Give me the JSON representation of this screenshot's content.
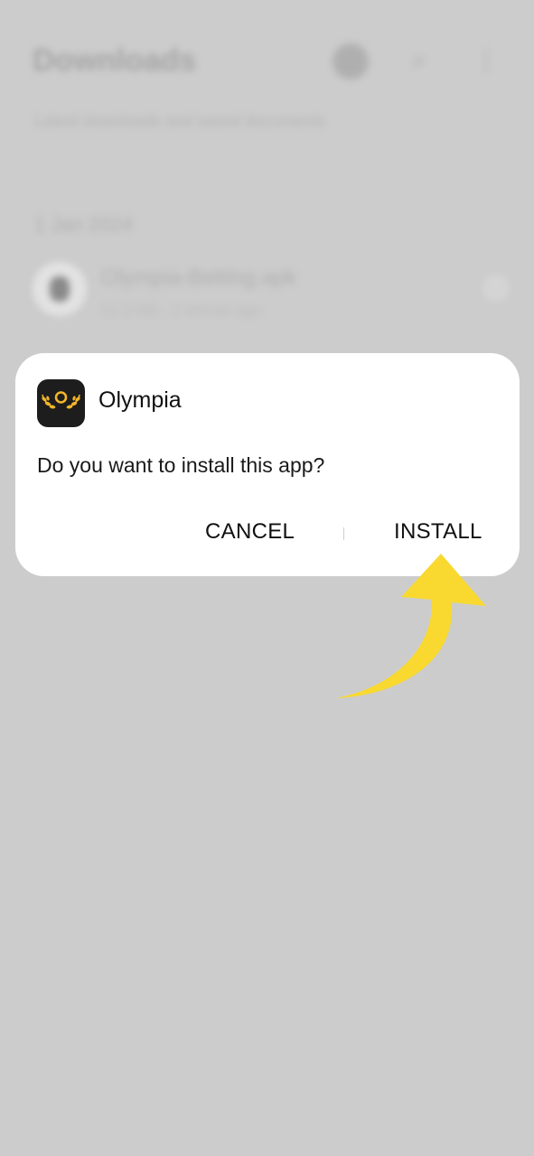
{
  "background": {
    "title": "Downloads",
    "subtitle": "Latest downloads and saved documents",
    "section_label": "1 Jan 2024",
    "file": {
      "name": "Olympia-Betting.apk",
      "meta": "21.3 MB · 1 minute ago"
    },
    "icons": [
      "sort-icon",
      "search-icon",
      "more-icon"
    ]
  },
  "dialog": {
    "app_name": "Olympia",
    "prompt": "Do you want to install this app?",
    "cancel_label": "CANCEL",
    "install_label": "INSTALL",
    "app_icon": "olympia-laurel-logo"
  },
  "colors": {
    "scrim": "#cccccc",
    "dialog": "#ffffff",
    "app_icon_bg": "#1d1d1d",
    "logo_gold": "#f2b52a",
    "arrow": "#f9d930"
  }
}
